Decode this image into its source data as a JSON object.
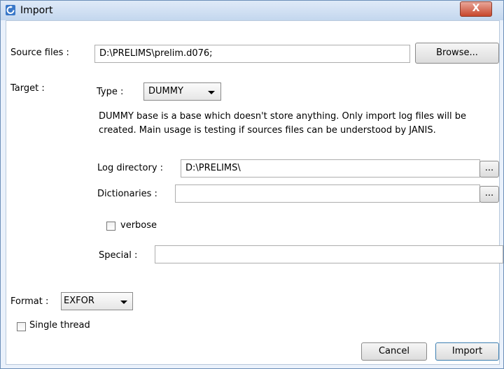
{
  "window": {
    "title": "Import",
    "close_glyph": "X"
  },
  "source": {
    "label": "Source files :",
    "value": "D:\\PRELIMS\\prelim.d076;",
    "browse_label": "Browse..."
  },
  "target": {
    "label": "Target :",
    "type_label": "Type :",
    "type_value": "DUMMY",
    "description": "DUMMY base is a base which doesn't store anything. Only import log files will be created. Main usage is testing if sources files can be understood by JANIS.",
    "log_label": "Log directory :",
    "log_value": "D:\\PRELIMS\\",
    "dict_label": "Dictionaries :",
    "dict_value": "",
    "ellipsis": "...",
    "verbose_label": "verbose",
    "special_label": "Special :",
    "special_value": ""
  },
  "format": {
    "label": "Format :",
    "value": "EXFOR"
  },
  "single_thread_label": "Single thread",
  "buttons": {
    "cancel": "Cancel",
    "import": "Import"
  },
  "colors": {
    "titlebar": "#c4d7ee",
    "close": "#c7462c",
    "window_bg": "#eaf1fb"
  }
}
